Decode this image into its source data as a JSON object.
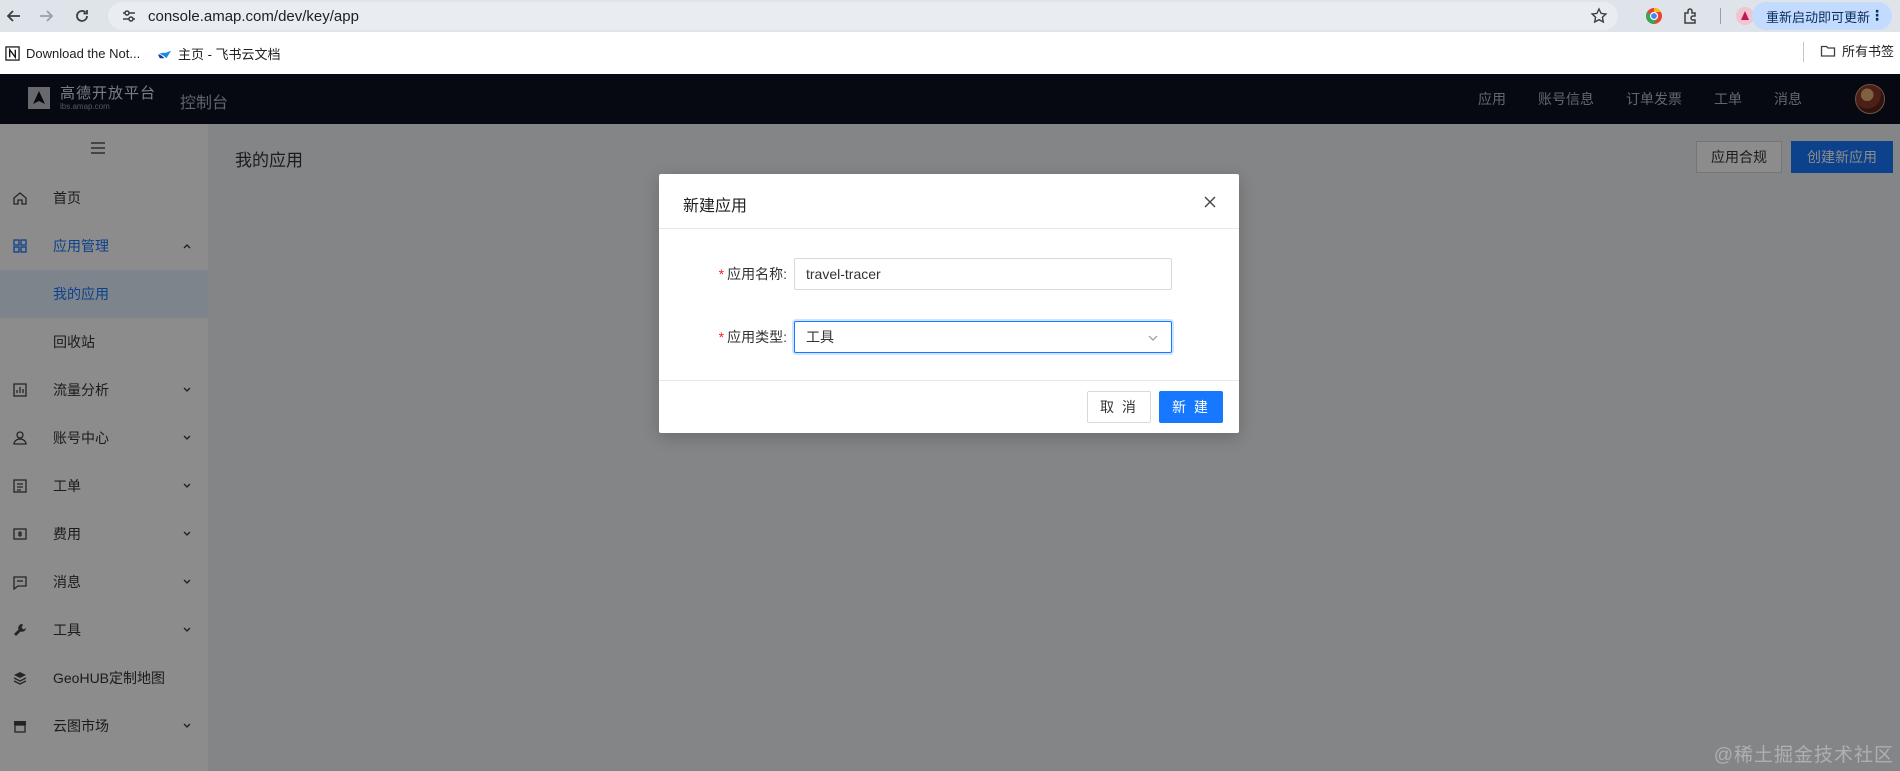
{
  "browser": {
    "url": "console.amap.com/dev/key/app",
    "update_label": "重新启动即可更新",
    "bookmarks": [
      {
        "label": "Download the Not..."
      },
      {
        "label": "主页 - 飞书云文档"
      }
    ],
    "all_bookmarks_label": "所有书签"
  },
  "header": {
    "logo_text": "高德开放平台",
    "logo_subtext": "lbs.amap.com",
    "console_title": "控制台",
    "nav": [
      "应用",
      "账号信息",
      "订单发票",
      "工单",
      "消息"
    ]
  },
  "sidebar": {
    "items": [
      {
        "label": "首页",
        "icon": "home-icon"
      },
      {
        "label": "应用管理",
        "icon": "grid-icon",
        "expanded": true
      },
      {
        "label": "我的应用",
        "sub": true,
        "selected": true
      },
      {
        "label": "回收站",
        "sub": true
      },
      {
        "label": "流量分析",
        "icon": "chart-icon"
      },
      {
        "label": "账号中心",
        "icon": "user-icon"
      },
      {
        "label": "工单",
        "icon": "ticket-icon"
      },
      {
        "label": "费用",
        "icon": "money-icon"
      },
      {
        "label": "消息",
        "icon": "message-icon"
      },
      {
        "label": "工具",
        "icon": "wrench-icon"
      },
      {
        "label": "GeoHUB定制地图",
        "icon": "layers-icon"
      },
      {
        "label": "云图市场",
        "icon": "store-icon"
      }
    ]
  },
  "main": {
    "title": "我的应用",
    "compliance_button": "应用合规",
    "create_button": "创建新应用"
  },
  "modal": {
    "title": "新建应用",
    "name_label": "应用名称:",
    "name_value": "travel-tracer",
    "type_label": "应用类型:",
    "type_value": "工具",
    "cancel_label": "取 消",
    "ok_label": "新 建"
  },
  "watermark": "@稀土掘金技术社区",
  "colors": {
    "primary": "#1677ff",
    "header_bg": "#0b1220",
    "required": "#f5222d"
  }
}
